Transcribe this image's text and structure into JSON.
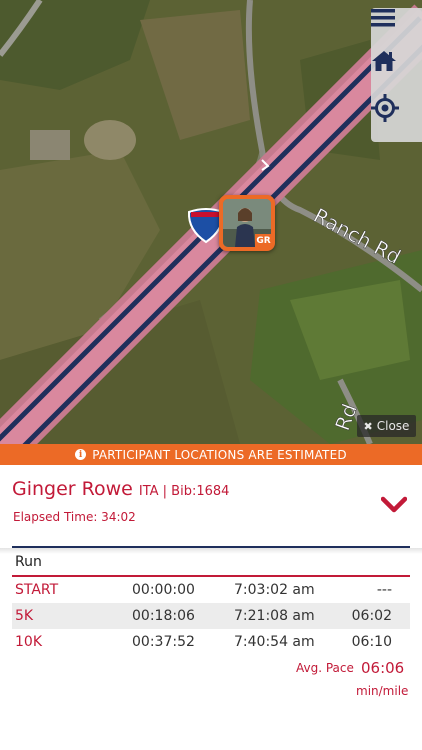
{
  "map": {
    "road_label": "Ranch Rd",
    "road_label_2": "Rd",
    "route_marker": "I-85",
    "marker_initials": "GR",
    "close_label": "Close"
  },
  "map_controls": [
    {
      "icon": "menu-icon"
    },
    {
      "icon": "home-icon"
    },
    {
      "icon": "locate-icon"
    }
  ],
  "banner": {
    "text": "PARTICIPANT LOCATIONS ARE ESTIMATED"
  },
  "participant": {
    "name": "Ginger Rowe",
    "meta": "ITA | Bib:1684",
    "elapsed": "Elapsed Time: 34:02"
  },
  "splits": {
    "event": "Run",
    "rows": [
      {
        "label": "START",
        "time": "00:00:00",
        "clock": "7:03:02 am",
        "pace": "---"
      },
      {
        "label": "5K",
        "time": "00:18:06",
        "clock": "7:21:08 am",
        "pace": "06:02"
      },
      {
        "label": "10K",
        "time": "00:37:52",
        "clock": "7:40:54 am",
        "pace": "06:10"
      }
    ],
    "avg_pace_label": "Avg. Pace",
    "avg_pace": "06:06",
    "avg_pace_unit": "min/mile"
  },
  "colors": {
    "accent": "#c21a38",
    "banner": "#ec6a26",
    "navy": "#1f2f5c"
  }
}
